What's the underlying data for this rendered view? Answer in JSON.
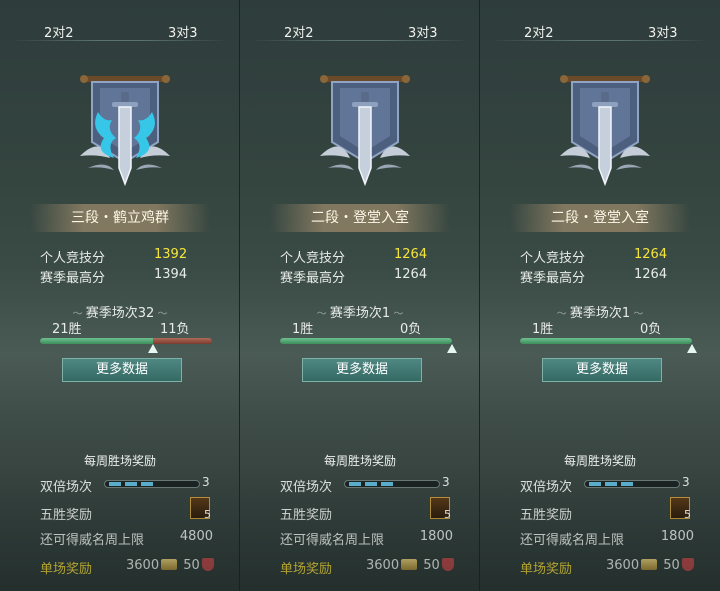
{
  "panels": [
    {
      "tabs": [
        "2对2",
        "3对3"
      ],
      "rank_title": "三段・鹤立鸡群",
      "emblem": "dragon-banner-icon",
      "emblem_color": "#36c7e8",
      "personal_score_label": "个人竞技分",
      "personal_score": "1392",
      "season_high_label": "赛季最高分",
      "season_high": "1394",
      "season_matches": "赛季场次32",
      "wins": "21胜",
      "losses": "11负",
      "win_ratio": 0.656,
      "more_data": "更多数据",
      "weekly_reward": "每周胜场奖励",
      "double_matches_label": "双倍场次",
      "double_count": "3",
      "five_win_label": "五胜奖励",
      "chest_count": "5",
      "remaining_label": "还可得威名周上限",
      "remaining_value": "4800",
      "single_reward_label": "单场奖励",
      "single_coin": "3600",
      "single_shield": "50"
    },
    {
      "tabs": [
        "2对2",
        "3对3"
      ],
      "rank_title": "二段・登堂入室",
      "emblem": "sword-banner-icon",
      "emblem_color": "#b9c4d0",
      "personal_score_label": "个人竞技分",
      "personal_score": "1264",
      "season_high_label": "赛季最高分",
      "season_high": "1264",
      "season_matches": "赛季场次1",
      "wins": "1胜",
      "losses": "0负",
      "win_ratio": 1.0,
      "more_data": "更多数据",
      "weekly_reward": "每周胜场奖励",
      "double_matches_label": "双倍场次",
      "double_count": "3",
      "five_win_label": "五胜奖励",
      "chest_count": "5",
      "remaining_label": "还可得威名周上限",
      "remaining_value": "1800",
      "single_reward_label": "单场奖励",
      "single_coin": "3600",
      "single_shield": "50"
    },
    {
      "tabs": [
        "2对2",
        "3对3"
      ],
      "rank_title": "二段・登堂入室",
      "emblem": "sword-banner-icon",
      "emblem_color": "#b9c4d0",
      "personal_score_label": "个人竞技分",
      "personal_score": "1264",
      "season_high_label": "赛季最高分",
      "season_high": "1264",
      "season_matches": "赛季场次1",
      "wins": "1胜",
      "losses": "0负",
      "win_ratio": 1.0,
      "more_data": "更多数据",
      "weekly_reward": "每周胜场奖励",
      "double_matches_label": "双倍场次",
      "double_count": "3",
      "five_win_label": "五胜奖励",
      "chest_count": "5",
      "remaining_label": "还可得威名周上限",
      "remaining_value": "1800",
      "single_reward_label": "单场奖励",
      "single_coin": "3600",
      "single_shield": "50"
    }
  ]
}
